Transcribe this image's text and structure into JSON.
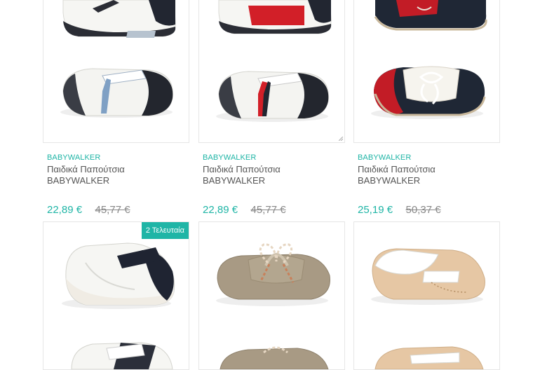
{
  "products": [
    {
      "brand": "BABYWALKER",
      "name": "Παιδικά Παπούτσια BABYWALKER",
      "price_new": "22,89 €",
      "price_old": "45,77 €",
      "image": "white-navy-velcro-shoe"
    },
    {
      "brand": "BABYWALKER",
      "name": "Παιδικά Παπούτσια BABYWALKER",
      "price_new": "22,89 €",
      "price_old": "45,77 €",
      "image": "white-red-navy-velcro-shoe"
    },
    {
      "brand": "BABYWALKER",
      "name": "Παιδικά Παπούτσια BABYWALKER",
      "price_new": "25,19 €",
      "price_old": "50,37 €",
      "image": "navy-red-boat-shoe"
    },
    {
      "badge": "2 Τελευταία",
      "image": "white-navy-velcro-shoe-2"
    },
    {
      "image": "beige-lace-loafer"
    },
    {
      "image": "beige-white-strap-loafer"
    }
  ],
  "colors": {
    "accent": "#1fb5a6",
    "border": "#e6e6e6",
    "text": "#555555",
    "old_price": "#888888"
  }
}
